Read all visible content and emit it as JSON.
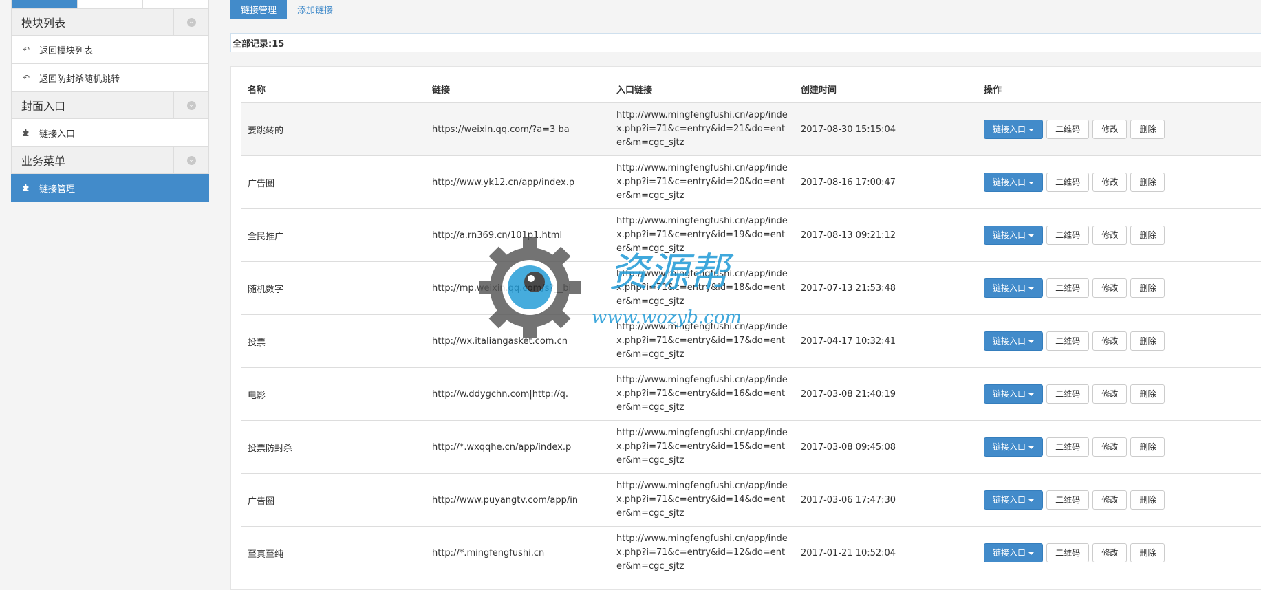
{
  "sidebar": {
    "tabs": [
      "",
      "",
      ""
    ],
    "sections": [
      {
        "title": "模块列表",
        "items": [
          {
            "label": "返回模块列表"
          },
          {
            "label": "返回防封杀随机跳转"
          }
        ]
      },
      {
        "title": "封面入口",
        "items": [
          {
            "label": "链接入口"
          }
        ]
      },
      {
        "title": "业务菜单",
        "items": [
          {
            "label": "链接管理",
            "active": true
          }
        ]
      }
    ]
  },
  "tabs": [
    {
      "label": "链接管理",
      "active": true
    },
    {
      "label": "添加链接"
    }
  ],
  "summary": "全部记录:15",
  "table": {
    "headers": [
      "名称",
      "链接",
      "入口链接",
      "创建时间",
      "操作"
    ],
    "action_labels": {
      "entry": "链接入口",
      "qrcode": "二维码",
      "edit": "修改",
      "delete": "删除"
    },
    "rows": [
      {
        "name": "要跳转的",
        "link": "https://weixin.qq.com/?a=3 ba",
        "entry": "http://www.mingfengfushi.cn/app/index.php?i=71&c=entry&id=21&do=enter&m=cgc_sjtz",
        "time": "2017-08-30 15:15:04"
      },
      {
        "name": "广告圈",
        "link": "http://www.yk12.cn/app/index.p",
        "entry": "http://www.mingfengfushi.cn/app/index.php?i=71&c=entry&id=20&do=enter&m=cgc_sjtz",
        "time": "2017-08-16 17:00:47"
      },
      {
        "name": "全民推广",
        "link": "http://a.rn369.cn/101p1.html",
        "entry": "http://www.mingfengfushi.cn/app/index.php?i=71&c=entry&id=19&do=enter&m=cgc_sjtz",
        "time": "2017-08-13 09:21:12"
      },
      {
        "name": "随机数字",
        "link": "http://mp.weixin.qq.com/s?__bi",
        "entry": "http://www.mingfengfushi.cn/app/index.php?i=71&c=entry&id=18&do=enter&m=cgc_sjtz",
        "time": "2017-07-13 21:53:48"
      },
      {
        "name": "投票",
        "link": "http://wx.italiangasket.com.cn",
        "entry": "http://www.mingfengfushi.cn/app/index.php?i=71&c=entry&id=17&do=enter&m=cgc_sjtz",
        "time": "2017-04-17 10:32:41"
      },
      {
        "name": "电影",
        "link": "http://w.ddygchn.com|http://q.",
        "entry": "http://www.mingfengfushi.cn/app/index.php?i=71&c=entry&id=16&do=enter&m=cgc_sjtz",
        "time": "2017-03-08 21:40:19"
      },
      {
        "name": "投票防封杀",
        "link": "http://*.wxqqhe.cn/app/index.p",
        "entry": "http://www.mingfengfushi.cn/app/index.php?i=71&c=entry&id=15&do=enter&m=cgc_sjtz",
        "time": "2017-03-08 09:45:08"
      },
      {
        "name": "广告圈",
        "link": "http://www.puyangtv.com/app/in",
        "entry": "http://www.mingfengfushi.cn/app/index.php?i=71&c=entry&id=14&do=enter&m=cgc_sjtz",
        "time": "2017-03-06 17:47:30"
      },
      {
        "name": "至真至纯",
        "link": "http://*.mingfengfushi.cn",
        "entry": "http://www.mingfengfushi.cn/app/index.php?i=71&c=entry&id=12&do=enter&m=cgc_sjtz",
        "time": "2017-01-21 10:52:04"
      }
    ]
  },
  "watermark": {
    "title": "资源帮",
    "url": "www.wozyb.com"
  }
}
